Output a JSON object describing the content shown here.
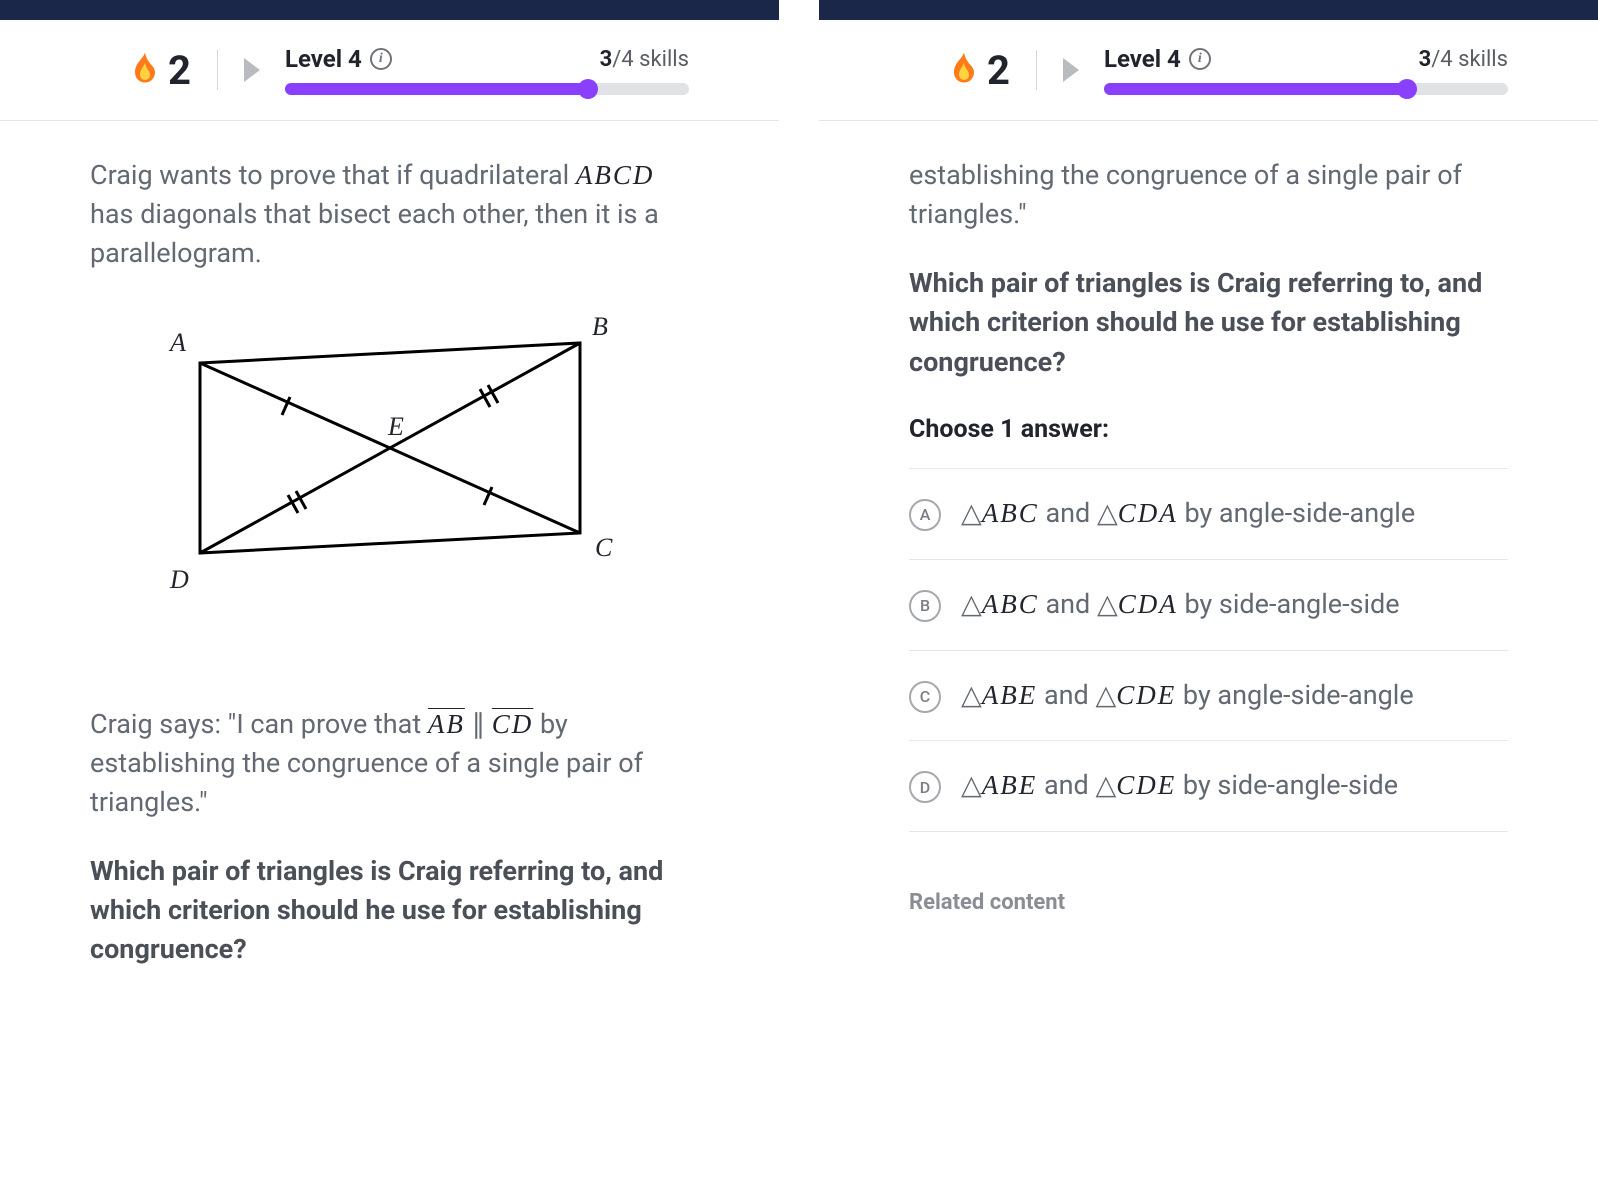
{
  "header": {
    "streak": "2",
    "level_label": "Level 4",
    "skills_done": "3",
    "skills_total": "/4 skills",
    "progress_percent": 75
  },
  "left": {
    "intro_pre": "Craig wants to prove that if quadrilateral ",
    "intro_var": "ABCD",
    "intro_post": " has diagonals that bisect each other, then it is a parallelogram.",
    "figure": {
      "A": "A",
      "B": "B",
      "C": "C",
      "D": "D",
      "E": "E"
    },
    "quote_pre": "Craig says: \"I can prove that ",
    "quote_ab": "AB",
    "quote_par": " ∥ ",
    "quote_cd": "CD",
    "quote_post": " by establishing the congruence of a single pair of triangles.\"",
    "question": "Which pair of triangles is Craig referring to, and which criterion should he use for establishing congruence?"
  },
  "right": {
    "tail": "establishing the congruence of a single pair of triangles.\"",
    "question": "Which pair of triangles is Craig referring to, and which criterion should he use for establishing congruence?",
    "choose": "Choose 1 answer:",
    "choices": [
      {
        "letter": "A",
        "t1": "ABC",
        "t2": "CDA",
        "by": " by angle-side-angle"
      },
      {
        "letter": "B",
        "t1": "ABC",
        "t2": "CDA",
        "by": " by side-angle-side"
      },
      {
        "letter": "C",
        "t1": "ABE",
        "t2": "CDE",
        "by": " by angle-side-angle"
      },
      {
        "letter": "D",
        "t1": "ABE",
        "t2": "CDE",
        "by": " by side-angle-side"
      }
    ],
    "related": "Related content"
  }
}
